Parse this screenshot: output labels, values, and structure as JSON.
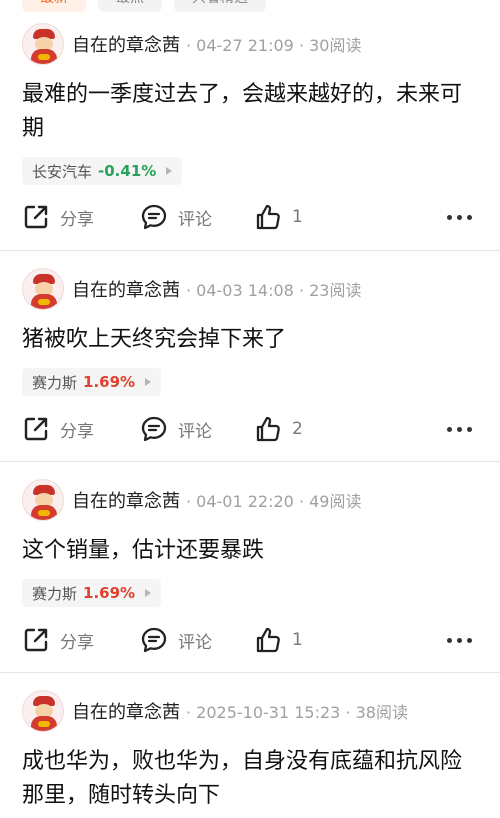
{
  "top_chips": [
    "最新",
    "最热",
    "只看精选"
  ],
  "posts": [
    {
      "author": "自在的章念茜",
      "meta": "· 04-27 21:09 · 30阅读",
      "content": "最难的一季度过去了，会越来越好的，未来可期",
      "stock": {
        "name": "长安汽车",
        "change": "-0.41%",
        "direction": "down"
      },
      "actions": {
        "share": "分享",
        "comment": "评论",
        "likes": "1"
      }
    },
    {
      "author": "自在的章念茜",
      "meta": "· 04-03 14:08 · 23阅读",
      "content": "猪被吹上天终究会掉下来了",
      "stock": {
        "name": "赛力斯",
        "change": "1.69%",
        "direction": "up"
      },
      "actions": {
        "share": "分享",
        "comment": "评论",
        "likes": "2"
      }
    },
    {
      "author": "自在的章念茜",
      "meta": "· 04-01 22:20 · 49阅读",
      "content": "这个销量，估计还要暴跌",
      "stock": {
        "name": "赛力斯",
        "change": "1.69%",
        "direction": "up"
      },
      "actions": {
        "share": "分享",
        "comment": "评论",
        "likes": "1"
      }
    },
    {
      "author": "自在的章念茜",
      "meta": "· 2025-10-31 15:23 · 38阅读",
      "content": "成也华为，败也华为，自身没有底蕴和抗风险那里，随时转头向下"
    }
  ],
  "colors": {
    "down": "#2aa15a",
    "up": "#e0412e",
    "accent": "#f36b21"
  }
}
